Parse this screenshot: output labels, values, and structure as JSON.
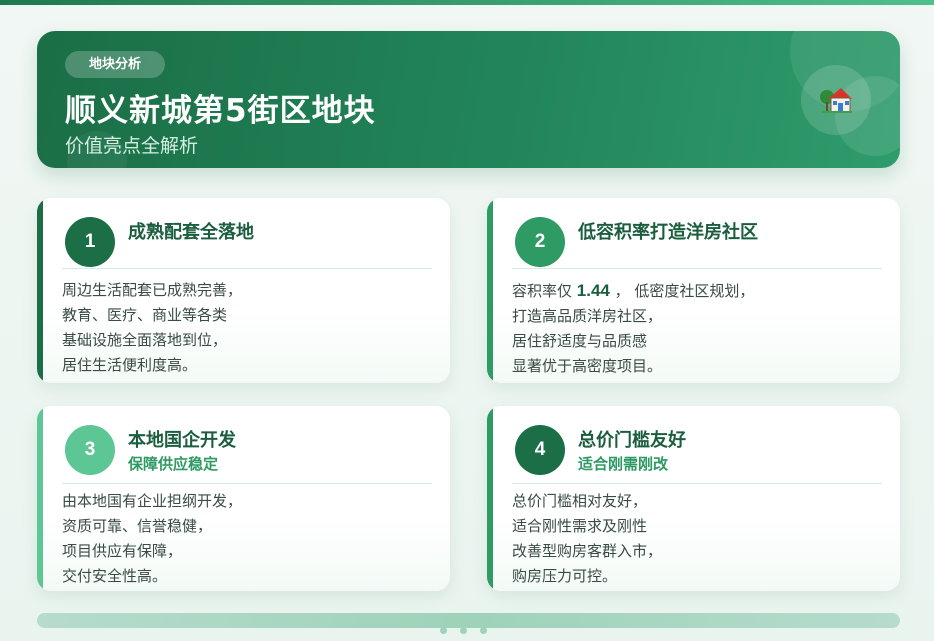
{
  "hero": {
    "tag": "地块分析",
    "title": "顺义新城第5街区地块",
    "subtitle": "价值亮点全解析",
    "icon": "house-icon"
  },
  "cards": [
    {
      "number": "1",
      "title": "成熟配套全落地",
      "subtitle": "",
      "accent": "#1b6e46",
      "lines": [
        "周边生活配套已成熟完善，",
        "教育、医疗、商业等各类",
        "基础设施全面落地到位，",
        "居住生活便利度高。"
      ]
    },
    {
      "number": "2",
      "title": "低容积率打造洋房社区",
      "subtitle": "",
      "accent": "#2e9a64",
      "line1_prefix": "容积率仅 ",
      "line1_value": "1.44",
      "line1_suffix": " ， 低密度社区规划，",
      "lines": [
        "打造高品质洋房社区，",
        "居住舒适度与品质感",
        "显著优于高密度项目。"
      ]
    },
    {
      "number": "3",
      "title": "本地国企开发",
      "subtitle": "保障供应稳定",
      "accent": "#5cc795",
      "lines": [
        "由本地国有企业担纲开发，",
        "资质可靠、信誉稳健，",
        "项目供应有保障，",
        "交付安全性高。"
      ]
    },
    {
      "number": "4",
      "title": "总价门槛友好",
      "subtitle": "适合刚需刚改",
      "accent": "#1b6e46",
      "lines": [
        "总价门槛相对友好，",
        "适合刚性需求及刚性",
        "改善型购房客群入市，",
        "购房压力可控。"
      ]
    }
  ],
  "colors": {
    "primary": "#1b6e46",
    "accent": "#2e9a64",
    "light": "#5cc795"
  }
}
